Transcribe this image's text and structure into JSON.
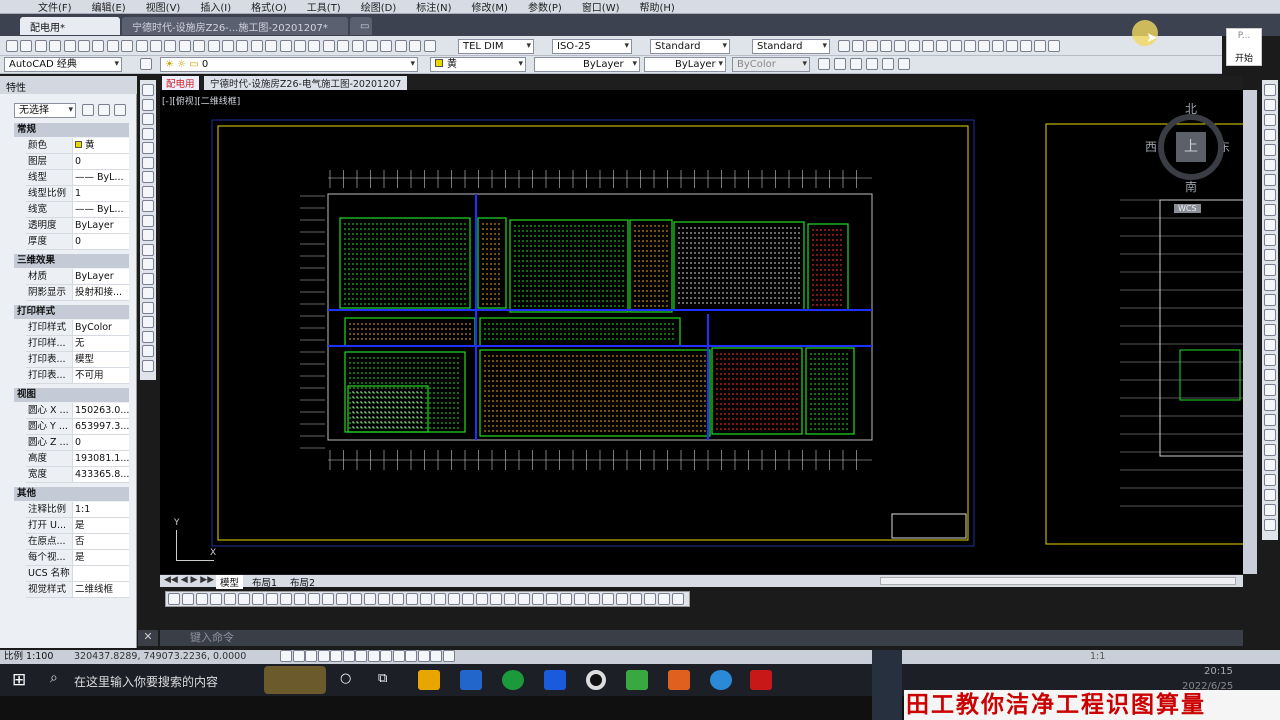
{
  "menu": [
    "文件(F)",
    "编辑(E)",
    "视图(V)",
    "插入(I)",
    "格式(O)",
    "工具(T)",
    "绘图(D)",
    "标注(N)",
    "修改(M)",
    "参数(P)",
    "窗口(W)",
    "帮助(H)"
  ],
  "file_tabs": [
    "配电用*",
    "宁德时代-设施房Z26-...施工图-20201207*"
  ],
  "toolbar": {
    "text_style": "TEL DIM",
    "dim_style": "ISO-25",
    "table_style": "Standard",
    "mleader_style": "Standard",
    "workspace": "AutoCAD 经典",
    "layer": "0",
    "color": "黄",
    "linetype": "ByLayer",
    "lineweight": "ByLayer",
    "plotstyle": "ByColor"
  },
  "start_button": {
    "title": "P...",
    "label": "开始"
  },
  "properties": {
    "title": "特性",
    "selection": "无选择",
    "sections": [
      {
        "name": "常规",
        "rows": [
          [
            "颜色",
            "黄"
          ],
          [
            "图层",
            "0"
          ],
          [
            "线型",
            "—— ByL..."
          ],
          [
            "线型比例",
            "1"
          ],
          [
            "线宽",
            "—— ByL..."
          ],
          [
            "透明度",
            "ByLayer"
          ],
          [
            "厚度",
            "0"
          ]
        ]
      },
      {
        "name": "三维效果",
        "rows": [
          [
            "材质",
            "ByLayer"
          ],
          [
            "阴影显示",
            "投射和接..."
          ]
        ]
      },
      {
        "name": "打印样式",
        "rows": [
          [
            "打印样式",
            "ByColor"
          ],
          [
            "打印样...",
            "无"
          ],
          [
            "打印表...",
            "模型"
          ],
          [
            "打印表...",
            "不可用"
          ]
        ]
      },
      {
        "name": "视图",
        "rows": [
          [
            "圆心 X ...",
            "150263.0..."
          ],
          [
            "圆心 Y ...",
            "653997.3..."
          ],
          [
            "圆心 Z ...",
            "0"
          ],
          [
            "高度",
            "193081.1..."
          ],
          [
            "宽度",
            "433365.8..."
          ]
        ]
      },
      {
        "name": "其他",
        "rows": [
          [
            "注释比例",
            "1:1"
          ],
          [
            "打开 U...",
            "是"
          ],
          [
            "在原点...",
            "否"
          ],
          [
            "每个视...",
            "是"
          ],
          [
            "UCS 名称",
            ""
          ],
          [
            "视觉样式",
            "二维线框"
          ]
        ]
      }
    ]
  },
  "drawing": {
    "tab_a": "配电用",
    "tab_b": "宁德时代-设施房Z26-电气施工图-20201207",
    "viewport_label": "[-][俯视][二维线框]",
    "viewcube": {
      "n": "北",
      "s": "南",
      "e": "东",
      "w": "西",
      "top": "上",
      "wcs": "WCS"
    },
    "ucs_y": "Y",
    "ucs_x": "X"
  },
  "layout_tabs": [
    "模型",
    "布局1",
    "布局2"
  ],
  "command_prompt": "键入命令",
  "status": {
    "scale": "比例 1:100",
    "coords": "320437.8289, 749073.2236, 0.0000",
    "model_scale": "1:1"
  },
  "taskbar": {
    "search": "在这里输入你要搜索的内容",
    "time": "20:15",
    "date": "2022/6/25"
  },
  "banner": "田工教你洁净工程识图算量",
  "colors": {
    "accent_yellow": "#e8d800",
    "drawing_green": "#22dd22",
    "drawing_blue": "#2030ff",
    "drawing_red": "#ff3020",
    "cursor_yellow": "#f0d860"
  }
}
